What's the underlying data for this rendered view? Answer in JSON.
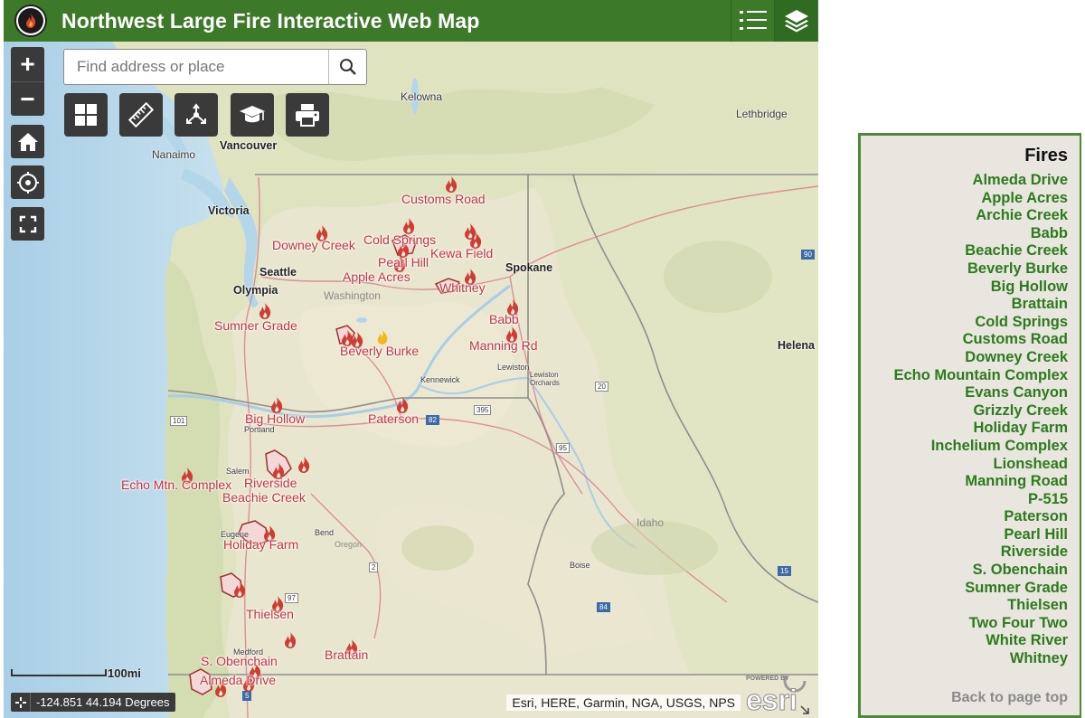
{
  "header": {
    "title": "Northwest Large Fire Interactive Web Map"
  },
  "search": {
    "placeholder": "Find address or place"
  },
  "map": {
    "fire_labels": [
      "Customs Road",
      "Downey Creek",
      "Cold Springs",
      "Pearl Hill",
      "Kewa Field",
      "Apple Acres",
      "Whitney",
      "Sumner Grade",
      "Babb",
      "Manning Rd",
      "Beverly Burke",
      "Big Hollow",
      "Paterson",
      "Echo Mtn. Complex",
      "Riverside",
      "Beachie Creek",
      "Holiday Farm",
      "Thielsen",
      "Brattain",
      "S. Obenchain",
      "Almeda Drive"
    ],
    "places": [
      "Kelowna",
      "Lethbridge",
      "Vancouver",
      "Nanaimo",
      "Victoria",
      "Seattle",
      "Olympia",
      "Spokane",
      "Washington",
      "Helena",
      "Kennewick",
      "Lewiston",
      "Lewiston Orchards",
      "Portland",
      "Salem",
      "Eugene",
      "Bend",
      "Oregon",
      "Idaho",
      "Boise",
      "Medford"
    ],
    "highway_shields": [
      "101",
      "97",
      "84",
      "95",
      "5",
      "82",
      "2",
      "20",
      "395",
      "90",
      "15"
    ],
    "scale": {
      "label": "100mi",
      "value": 100,
      "unit": "mi"
    },
    "coordinates": "-124.851 44.194 Degrees",
    "attribution": "Esri, HERE, Garmin, NGA, USGS, NPS",
    "esri_logo_text": "POWERED BY esri",
    "colors": {
      "fire": "#c8323c",
      "header": "#3c7a2a",
      "panel_link": "#2e7a1e"
    }
  },
  "panel": {
    "title": "Fires",
    "fires": [
      "Almeda Drive",
      "Apple Acres",
      "Archie Creek",
      "Babb",
      "Beachie Creek",
      "Beverly Burke",
      "Big Hollow",
      "Brattain",
      "Cold Springs",
      "Customs Road",
      "Downey Creek",
      "Echo Mountain Complex",
      "Evans Canyon",
      "Grizzly Creek",
      "Holiday Farm",
      "Inchelium Complex",
      "Lionshead",
      "Manning Road",
      "P-515",
      "Paterson",
      "Pearl Hill",
      "Riverside",
      "S. Obenchain",
      "Sumner Grade",
      "Thielsen",
      "Two Four Two",
      "White River",
      "Whitney"
    ],
    "back_to_top": "Back to page top"
  }
}
